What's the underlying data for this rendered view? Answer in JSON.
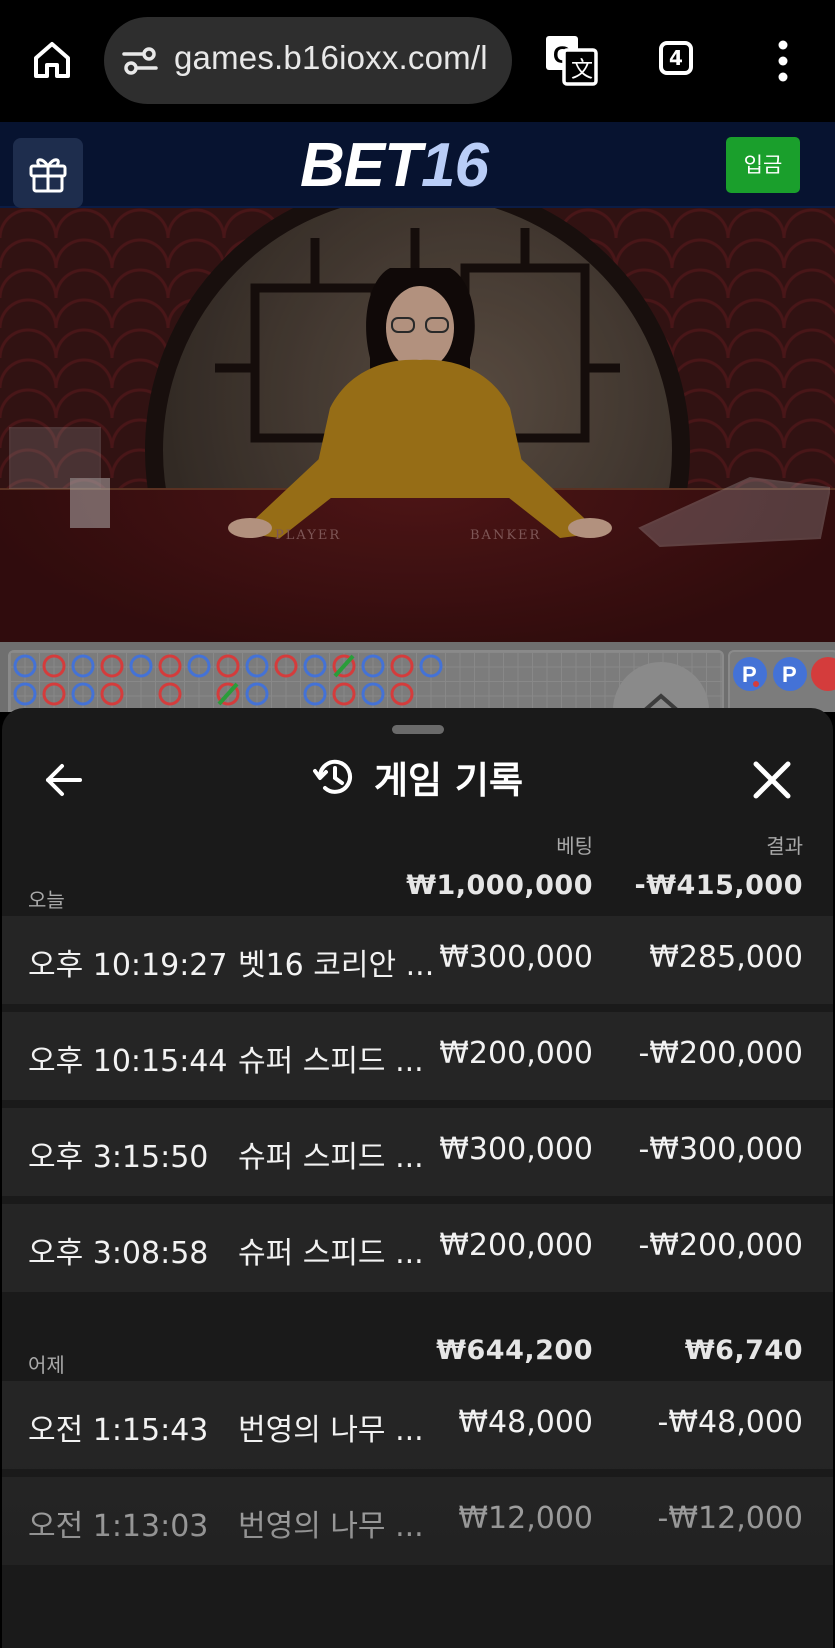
{
  "browser": {
    "url": "games.b16ioxx.com/l",
    "tab_count": "4",
    "icons": [
      "home-icon",
      "site-settings-icon",
      "translate-icon",
      "tabs-icon",
      "more-vert-icon"
    ]
  },
  "site": {
    "logo_part1": "BET",
    "logo_part2": "16",
    "deposit_label": "입금",
    "brand_color": "#1a9f2c",
    "header_bg": "#071330"
  },
  "video": {
    "felt_player": "PLAYER",
    "felt_banker": "BANKER"
  },
  "roadmap": {
    "badge1": "P",
    "badge2": "P"
  },
  "sheet": {
    "title": "게임 기록",
    "col_bet": "베팅",
    "col_result": "결과",
    "groups": [
      {
        "label": "오늘",
        "bet_total": "₩1,000,000",
        "result_total": "-₩415,000",
        "rows": [
          {
            "time": "오후 10:19:27",
            "game": "벳16 코리안 ...",
            "bet": "₩300,000",
            "result": "₩285,000"
          },
          {
            "time": "오후 10:15:44",
            "game": "슈퍼 스피드 ...",
            "bet": "₩200,000",
            "result": "-₩200,000"
          },
          {
            "time": "오후 3:15:50",
            "game": "슈퍼 스피드 ...",
            "bet": "₩300,000",
            "result": "-₩300,000"
          },
          {
            "time": "오후 3:08:58",
            "game": "슈퍼 스피드 ...",
            "bet": "₩200,000",
            "result": "-₩200,000"
          }
        ]
      },
      {
        "label": "어제",
        "bet_total": "₩644,200",
        "result_total": "₩6,740",
        "rows": [
          {
            "time": "오전 1:15:43",
            "game": "번영의 나무 ...",
            "bet": "₩48,000",
            "result": "-₩48,000"
          },
          {
            "time": "오전 1:13:03",
            "game": "번영의 나무 ...",
            "bet": "₩12,000",
            "result": "-₩12,000"
          }
        ]
      }
    ]
  }
}
